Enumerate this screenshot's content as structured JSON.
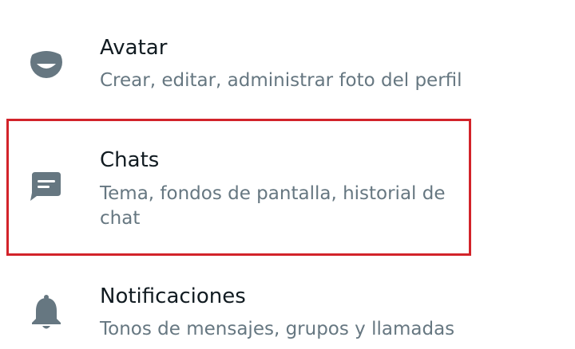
{
  "settings": {
    "items": [
      {
        "id": "avatar",
        "icon": "avatar-face-icon",
        "title": "Avatar",
        "subtitle": "Crear, editar, administrar foto del perfil"
      },
      {
        "id": "chats",
        "icon": "chat-bubble-icon",
        "title": "Chats",
        "subtitle": "Tema, fondos de pantalla, historial de chat"
      },
      {
        "id": "notifications",
        "icon": "bell-icon",
        "title": "Notificaciones",
        "subtitle": "Tonos de mensajes, grupos y llamadas"
      }
    ]
  },
  "highlight": {
    "target": "chats",
    "color": "#d2232a"
  },
  "colors": {
    "icon": "#667781",
    "title": "#111b21",
    "subtitle": "#667781"
  }
}
